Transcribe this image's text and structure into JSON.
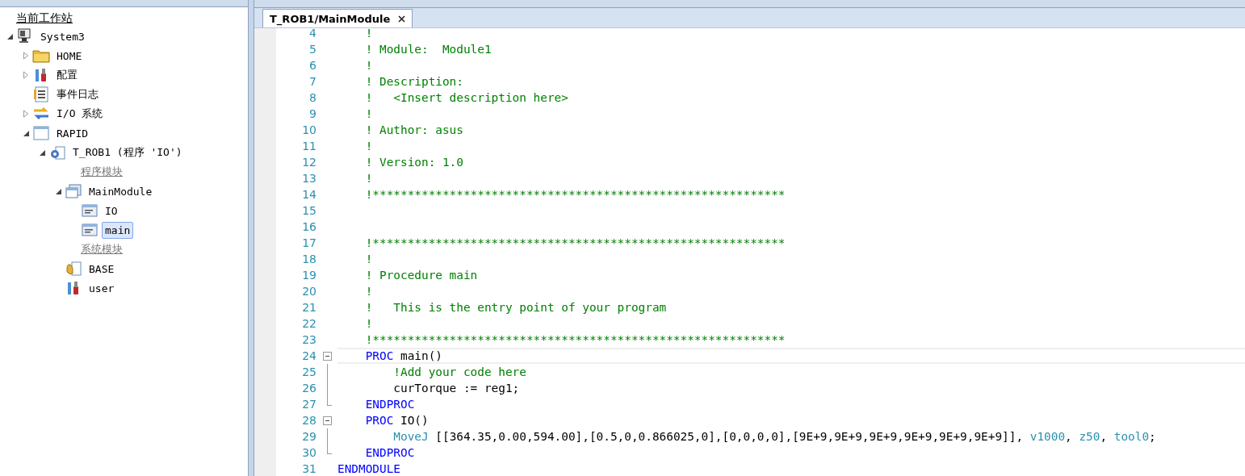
{
  "explorer": {
    "header": "当前工作站",
    "items": [
      {
        "label": "System3",
        "kind": "computer",
        "expanded": true,
        "selected": false,
        "children": [
          {
            "label": "HOME",
            "kind": "folder",
            "expanded": false,
            "selected": false
          },
          {
            "label": "配置",
            "kind": "config",
            "expanded": false,
            "selected": false
          },
          {
            "label": "事件日志",
            "kind": "log",
            "selected": false
          },
          {
            "label": "I/O 系统",
            "kind": "io",
            "expanded": false,
            "selected": false
          },
          {
            "label": "RAPID",
            "kind": "window",
            "expanded": true,
            "selected": false,
            "children": [
              {
                "label": "T_ROB1 (程序 'IO')",
                "kind": "task",
                "expanded": true,
                "selected": false,
                "children": [
                  {
                    "label": "程序模块",
                    "kind": "group",
                    "selected": false
                  },
                  {
                    "label": "MainModule",
                    "kind": "module",
                    "expanded": true,
                    "selected": false,
                    "children": [
                      {
                        "label": "IO",
                        "kind": "routine",
                        "selected": false
                      },
                      {
                        "label": "main",
                        "kind": "routine",
                        "selected": true
                      }
                    ]
                  },
                  {
                    "label": "系统模块",
                    "kind": "group",
                    "selected": false
                  },
                  {
                    "label": "BASE",
                    "kind": "hand",
                    "selected": false
                  },
                  {
                    "label": "user",
                    "kind": "config",
                    "selected": false
                  }
                ]
              }
            ]
          }
        ]
      }
    ]
  },
  "editor": {
    "tabs": [
      {
        "label": "T_ROB1/MainModule",
        "selected": true
      }
    ],
    "lines": [
      {
        "number": "4",
        "kind": "text",
        "current": false,
        "tokens": [
          {
            "kind": "comment",
            "text": "    !"
          }
        ]
      },
      {
        "number": "5",
        "kind": "text",
        "current": false,
        "tokens": [
          {
            "kind": "comment",
            "text": "    ! Module:  Module1"
          }
        ]
      },
      {
        "number": "6",
        "kind": "text",
        "current": false,
        "tokens": [
          {
            "kind": "comment",
            "text": "    !"
          }
        ]
      },
      {
        "number": "7",
        "kind": "text",
        "current": false,
        "tokens": [
          {
            "kind": "comment",
            "text": "    ! Description:"
          }
        ]
      },
      {
        "number": "8",
        "kind": "text",
        "current": false,
        "tokens": [
          {
            "kind": "comment",
            "text": "    !   <Insert description here>"
          }
        ]
      },
      {
        "number": "9",
        "kind": "text",
        "current": false,
        "tokens": [
          {
            "kind": "comment",
            "text": "    !"
          }
        ]
      },
      {
        "number": "10",
        "kind": "text",
        "current": false,
        "tokens": [
          {
            "kind": "comment",
            "text": "    ! Author: asus"
          }
        ]
      },
      {
        "number": "11",
        "kind": "text",
        "current": false,
        "tokens": [
          {
            "kind": "comment",
            "text": "    !"
          }
        ]
      },
      {
        "number": "12",
        "kind": "text",
        "current": false,
        "tokens": [
          {
            "kind": "comment",
            "text": "    ! Version: 1.0"
          }
        ]
      },
      {
        "number": "13",
        "kind": "text",
        "current": false,
        "tokens": [
          {
            "kind": "comment",
            "text": "    !"
          }
        ]
      },
      {
        "number": "14",
        "kind": "text",
        "current": false,
        "tokens": [
          {
            "kind": "comment",
            "text": "    !***********************************************************"
          }
        ]
      },
      {
        "number": "15",
        "kind": "text",
        "current": false
      },
      {
        "number": "16",
        "kind": "text",
        "current": false
      },
      {
        "number": "17",
        "kind": "text",
        "current": false,
        "tokens": [
          {
            "kind": "comment",
            "text": "    !***********************************************************"
          }
        ]
      },
      {
        "number": "18",
        "kind": "text",
        "current": false,
        "tokens": [
          {
            "kind": "comment",
            "text": "    !"
          }
        ]
      },
      {
        "number": "19",
        "kind": "text",
        "current": false,
        "tokens": [
          {
            "kind": "comment",
            "text": "    ! Procedure main"
          }
        ]
      },
      {
        "number": "20",
        "kind": "text",
        "current": false,
        "tokens": [
          {
            "kind": "comment",
            "text": "    !"
          }
        ]
      },
      {
        "number": "21",
        "kind": "text",
        "current": false,
        "tokens": [
          {
            "kind": "comment",
            "text": "    !   This is the entry point of your program"
          }
        ]
      },
      {
        "number": "22",
        "kind": "text",
        "current": false,
        "tokens": [
          {
            "kind": "comment",
            "text": "    !"
          }
        ]
      },
      {
        "number": "23",
        "kind": "text",
        "current": false,
        "tokens": [
          {
            "kind": "comment",
            "text": "    !***********************************************************"
          }
        ]
      },
      {
        "number": "24",
        "kind": "fold-start",
        "current": true,
        "tokens": [
          {
            "kind": "keyword",
            "text": "    PROC"
          },
          {
            "kind": "plain",
            "text": " main()"
          }
        ]
      },
      {
        "number": "25",
        "kind": "fold-body",
        "current": false,
        "tokens": [
          {
            "kind": "comment",
            "text": "        !Add your code here"
          }
        ]
      },
      {
        "number": "26",
        "kind": "fold-body",
        "current": false,
        "tokens": [
          {
            "kind": "plain",
            "text": "        curTorque := reg1;"
          }
        ]
      },
      {
        "number": "27",
        "kind": "fold-end",
        "current": false,
        "tokens": [
          {
            "kind": "keyword",
            "text": "    ENDPROC"
          }
        ]
      },
      {
        "number": "28",
        "kind": "fold-start",
        "current": false,
        "tokens": [
          {
            "kind": "keyword",
            "text": "    PROC"
          },
          {
            "kind": "plain",
            "text": " IO()"
          }
        ]
      },
      {
        "number": "29",
        "kind": "fold-body",
        "current": false,
        "tokens": [
          {
            "kind": "builtin",
            "text": "        MoveJ"
          },
          {
            "kind": "plain",
            "text": " [[364.35,0.00,594.00],[0.5,0,0.866025,0],[0,0,0,0],[9E+9,9E+9,9E+9,9E+9,9E+9,9E+9]], "
          },
          {
            "kind": "builtin",
            "text": "v1000"
          },
          {
            "kind": "plain",
            "text": ", "
          },
          {
            "kind": "builtin",
            "text": "z50"
          },
          {
            "kind": "plain",
            "text": ", "
          },
          {
            "kind": "builtin",
            "text": "tool0"
          },
          {
            "kind": "plain",
            "text": ";"
          }
        ]
      },
      {
        "number": "30",
        "kind": "fold-end",
        "current": false,
        "tokens": [
          {
            "kind": "keyword",
            "text": "    ENDPROC"
          }
        ]
      },
      {
        "number": "31",
        "kind": "text",
        "current": false,
        "tokens": [
          {
            "kind": "keyword",
            "text": "ENDMODULE"
          }
        ]
      }
    ]
  }
}
